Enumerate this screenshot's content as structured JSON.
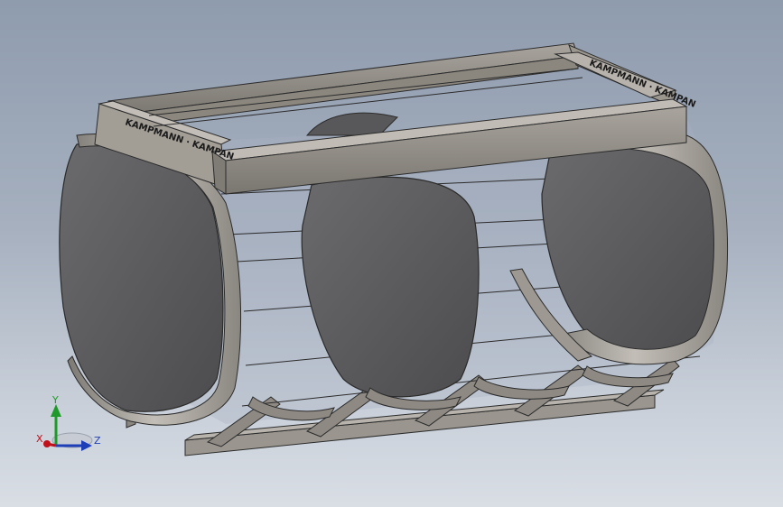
{
  "viewport": {
    "background_top": "#8f9cae",
    "background_bottom": "#d9dee5"
  },
  "model": {
    "frame_brand_text_left": "KAMPMANN · KAMPAN",
    "frame_brand_text_right": "KAMPMANN · KAMPAN",
    "colors": {
      "dark_panel": "#58585a",
      "metal": "#8c8882",
      "metal_light": "#b5b1aa",
      "edge": "#2b2b2b",
      "glass": "#a8b3c4"
    }
  },
  "triad": {
    "x_label": "X",
    "y_label": "Y",
    "z_label": "Z",
    "x_color": "#c0101a",
    "y_color": "#1f9a2a",
    "z_color": "#1f3fb8"
  }
}
